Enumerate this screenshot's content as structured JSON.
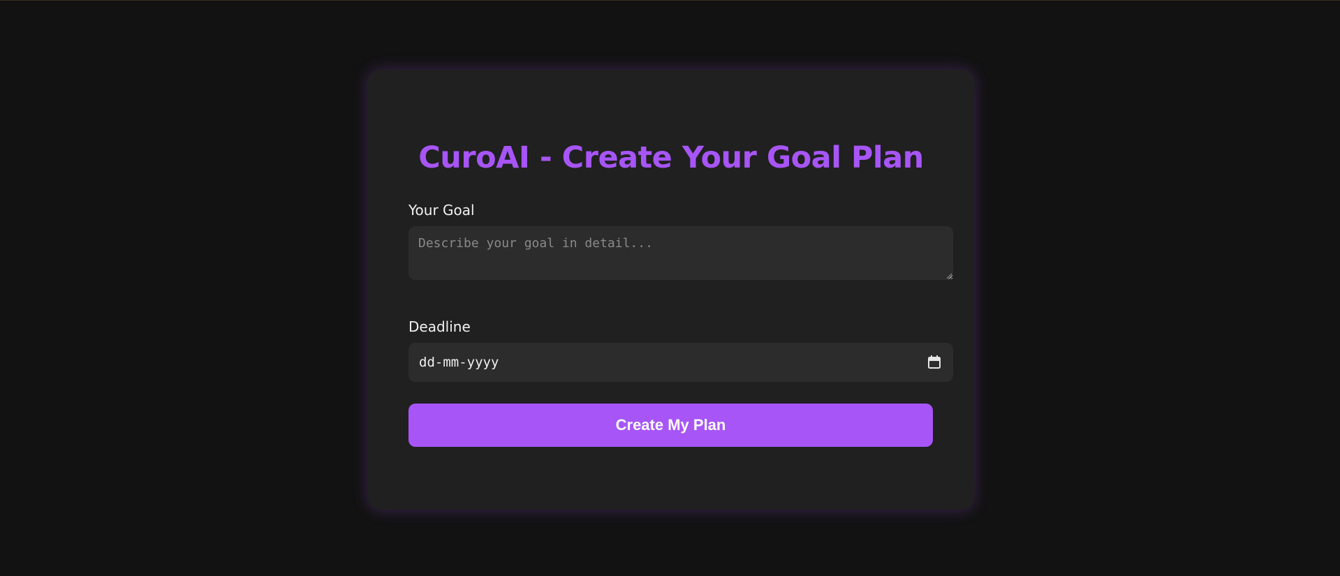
{
  "form": {
    "title": "CuroAI - Create Your Goal Plan",
    "goal_label": "Your Goal",
    "goal_placeholder": "Describe your goal in detail...",
    "goal_value": "",
    "deadline_label": "Deadline",
    "deadline_placeholder": "dd-mm-yyyy",
    "calendar_icon": "calendar-icon",
    "submit_label": "Create My Plan"
  },
  "colors": {
    "accent": "#a855f7",
    "page_background": "#121212",
    "card_background": "#202020",
    "field_background": "#2c2c2c"
  }
}
